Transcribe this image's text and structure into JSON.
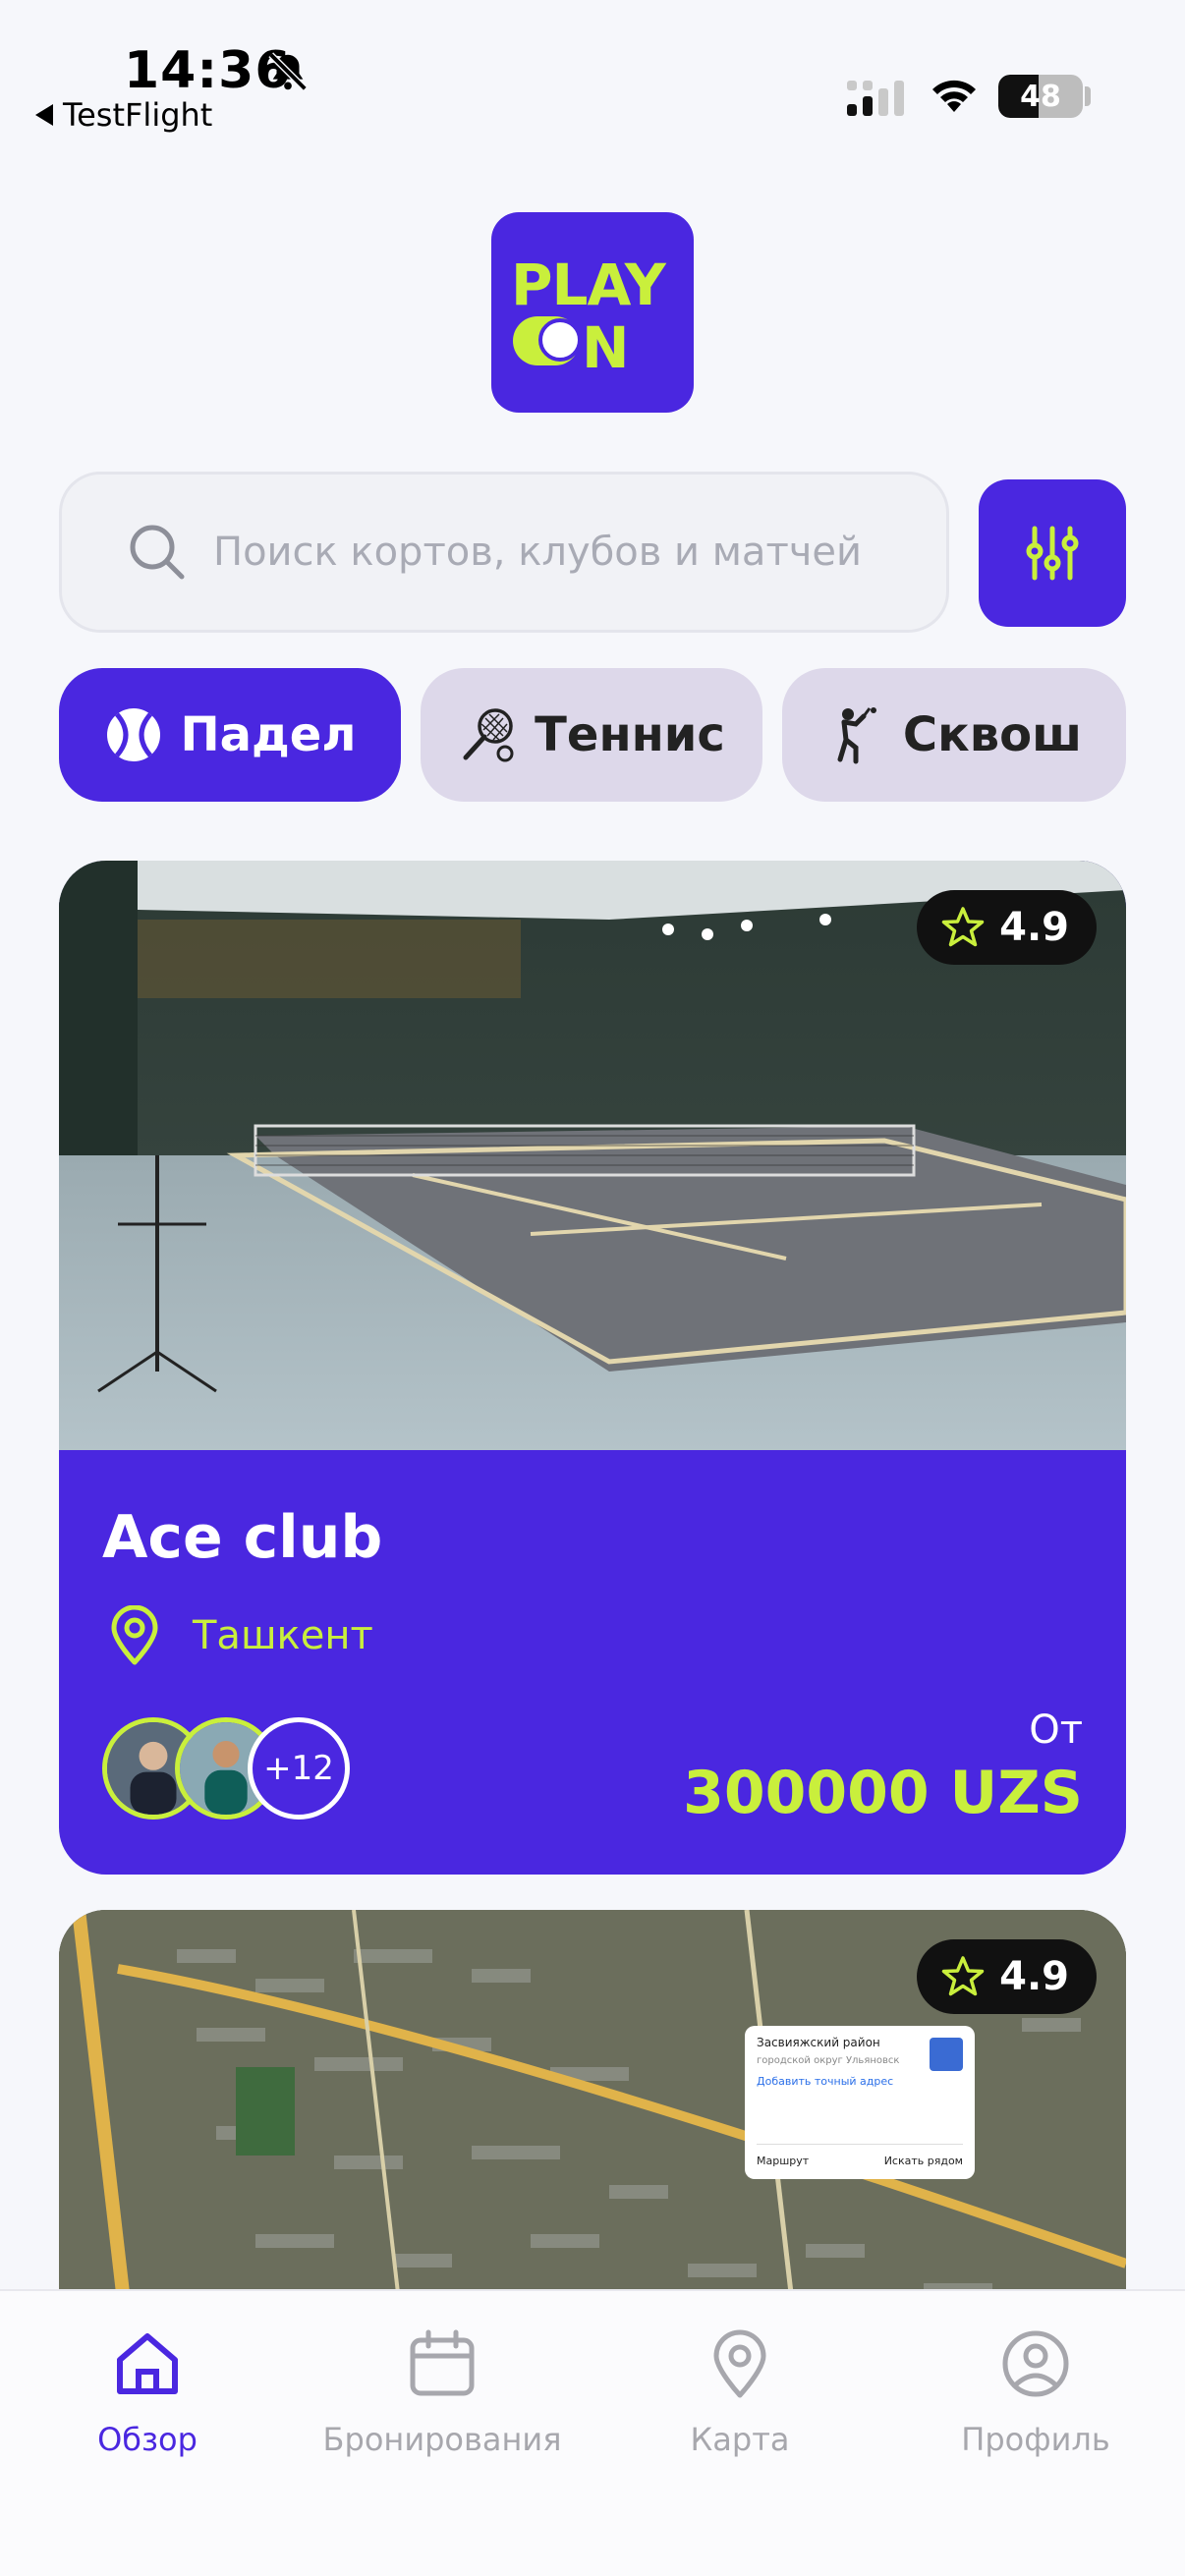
{
  "status_bar": {
    "time": "14:36",
    "back_app": "TestFlight",
    "battery": "48",
    "battery_level": 0.48
  },
  "logo": {
    "line1": "PLAY",
    "line2": "N"
  },
  "search": {
    "placeholder": "Поиск кортов, клубов и матчей"
  },
  "sports": [
    {
      "label": "Падел",
      "icon": "padel-ball-icon",
      "active": true
    },
    {
      "label": "Теннис",
      "icon": "tennis-racket-icon",
      "active": false
    },
    {
      "label": "Сквош",
      "icon": "squash-player-icon",
      "active": false
    }
  ],
  "venues": [
    {
      "rating": "4.9",
      "name": "Ace club",
      "city": "Ташкент",
      "more_players": "+12",
      "price_prefix": "От",
      "price": "300000 UZS"
    },
    {
      "rating": "4.9",
      "map_popup": {
        "title": "Засвияжский район",
        "subtitle": "городской округ Ульяновск",
        "link": "Добавить точный адрес",
        "route": "Маршрут",
        "search_nearby": "Искать рядом"
      }
    }
  ],
  "tabbar": [
    {
      "label": "Обзор",
      "icon": "home-icon",
      "active": true
    },
    {
      "label": "Бронирования",
      "icon": "calendar-icon",
      "active": false
    },
    {
      "label": "Карта",
      "icon": "map-pin-icon",
      "active": false
    },
    {
      "label": "Профиль",
      "icon": "profile-icon",
      "active": false
    }
  ],
  "colors": {
    "brand": "#4a27e0",
    "accent": "#c9ef3c",
    "chip_inactive": "#ddd8ea",
    "tab_inactive": "#a7a7ad"
  }
}
